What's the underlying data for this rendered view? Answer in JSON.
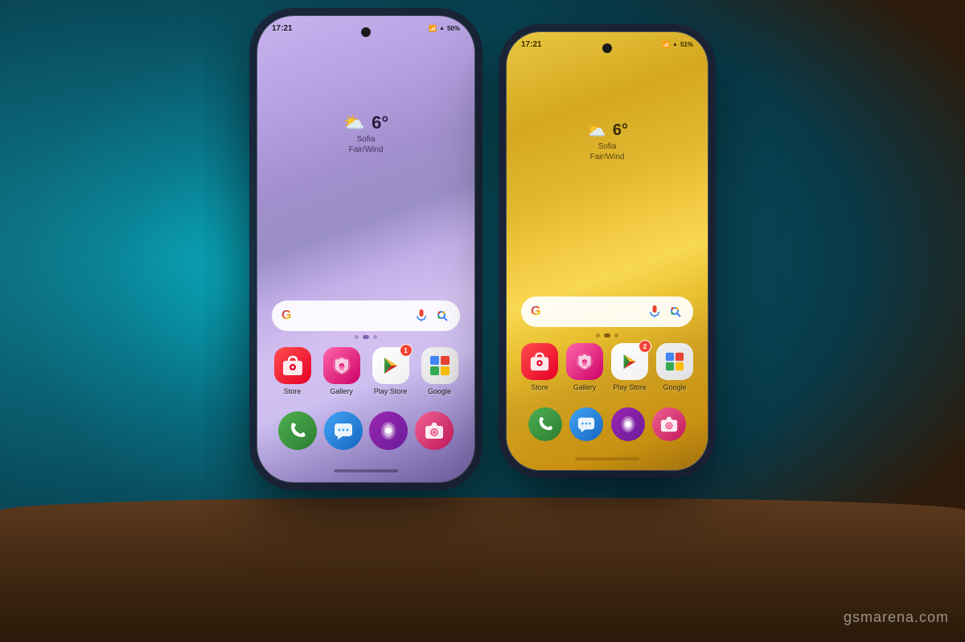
{
  "background": {
    "color_main": "#1a6a7a",
    "color_teal": "#0e8a9a"
  },
  "watermark": {
    "text": "gsmarena.com"
  },
  "phone_left": {
    "color": "purple",
    "status_bar": {
      "time": "17:21",
      "battery": "50%",
      "signal": "●●●"
    },
    "weather": {
      "temperature": "6°",
      "city": "Sofia",
      "condition": "Fair/Wind"
    },
    "search": {
      "placeholder": ""
    },
    "apps": [
      {
        "name": "Store",
        "icon": "store",
        "badge": ""
      },
      {
        "name": "Gallery",
        "icon": "gallery",
        "badge": ""
      },
      {
        "name": "Play Store",
        "icon": "playstore",
        "badge": "1"
      },
      {
        "name": "Google",
        "icon": "google",
        "badge": ""
      }
    ],
    "dock": [
      {
        "name": "Phone",
        "icon": "phone"
      },
      {
        "name": "Messages",
        "icon": "messages"
      },
      {
        "name": "Samsung Free",
        "icon": "samsung"
      },
      {
        "name": "Camera",
        "icon": "camera"
      }
    ]
  },
  "phone_right": {
    "color": "gold",
    "status_bar": {
      "time": "17:21",
      "battery": "51%",
      "signal": "●●●"
    },
    "weather": {
      "temperature": "6°",
      "city": "Sofia",
      "condition": "Fair/Wind"
    },
    "apps": [
      {
        "name": "Store",
        "icon": "store",
        "badge": ""
      },
      {
        "name": "Gallery",
        "icon": "gallery",
        "badge": ""
      },
      {
        "name": "Play Store",
        "icon": "playstore",
        "badge": "2"
      },
      {
        "name": "Google",
        "icon": "google",
        "badge": ""
      }
    ],
    "dock": [
      {
        "name": "Phone",
        "icon": "phone"
      },
      {
        "name": "Messages",
        "icon": "messages"
      },
      {
        "name": "Samsung Free",
        "icon": "samsung"
      },
      {
        "name": "Camera",
        "icon": "camera"
      }
    ]
  }
}
